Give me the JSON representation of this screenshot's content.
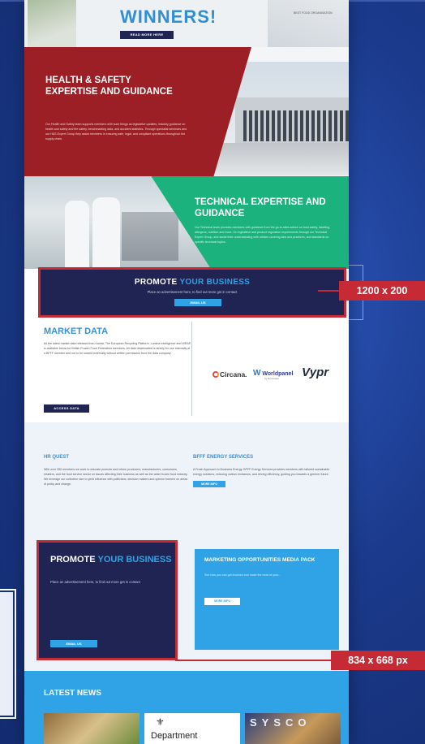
{
  "top": {
    "title": "WINNERS!",
    "button": "READ MORE HERE",
    "tiny": "BEST FOOD ORGANISATION"
  },
  "health_safety": {
    "title": "HEALTH & SAFETY EXPERTISE AND GUIDANCE",
    "body": "Our Health and Safety team supports members with such things as legislative updates, industry guidance on health and safety and fire safety, benchmarking data, and accident statistics. Through specialist seminars and our H&S Expert Group they assist members in ensuring safe, legal, and compliant operations throughout the supply chain."
  },
  "technical": {
    "title": "TECHNICAL EXPERTISE AND GUIDANCE",
    "body": "Our Technical team provides members with guidance from the go-to-sites advice on food safety, labelling, allergens, nutrition and more. On legislative and product regulation requirements through our Technical Expert Group, and assist their understanding with articles covering labs and practices, and standards on specific technical topics."
  },
  "promo_banner": {
    "title_a": "PROMOTE",
    "title_b": "YOUR BUSINESS",
    "subtitle": "Place an advertisement here, to find out more get in contact",
    "button": "EMAIL US"
  },
  "market": {
    "title": "MARKET DATA",
    "body": "All the latest market data released from Kantar, The European Recycling Platform, Lumina Intelligence and WRAP is available below for British Frozen Food Federation members. All data downloaded is strictly for use internally at a BFFF member and not to be shared externally without written permission from the data company.",
    "button": "ACCESS DATA",
    "logos": {
      "circana": "Circana.",
      "worldpanel": "Worldpanel",
      "worldpanel_sub": "by Numerator",
      "vypr": "Vypr"
    }
  },
  "hr": {
    "title": "HR QUEST",
    "body": "With over 350 members we work to educate promote and inform producers, manufacturers, consumers, retailers, and the food service sector on issues affecting their business as well as the wider frozen food industry. We leverage our collective size to yield influence with politicians, decision makers and opinion formers on areas of policy and change.",
    "button": "MORE INFO"
  },
  "energy": {
    "title": "BFFF ENERGY SERVICES",
    "body": "A Fresh Approach to Business Energy. BFFF Energy Services provides members with tailored sustainable energy solutions, reducing carbon emissions, and driving efficiency, guiding you towards a greener future.",
    "button": "MORE INFO"
  },
  "promo_box": {
    "title_a": "PROMOTE",
    "title_b": "YOUR BUSINESS",
    "body": "Place an advertisement here, to find out more get in contact",
    "button": "EMAIL US"
  },
  "marketing": {
    "title": "MARKETING OPPORTUNITIES MEDIA PACK",
    "body": "See how you can get involved and make the most of your...",
    "button": "MORE INFO"
  },
  "news": {
    "title": "LATEST NEWS",
    "dept": "Department",
    "sysco": "SYSCO"
  },
  "callouts": {
    "banner_size": "1200 x 200",
    "box_size": "834 x 668 px"
  },
  "colors": {
    "navy": "#1f2452",
    "accent_blue": "#2fa3e6",
    "red": "#9b1f24",
    "green": "#1cb27e",
    "callout_red": "#c62b35"
  }
}
